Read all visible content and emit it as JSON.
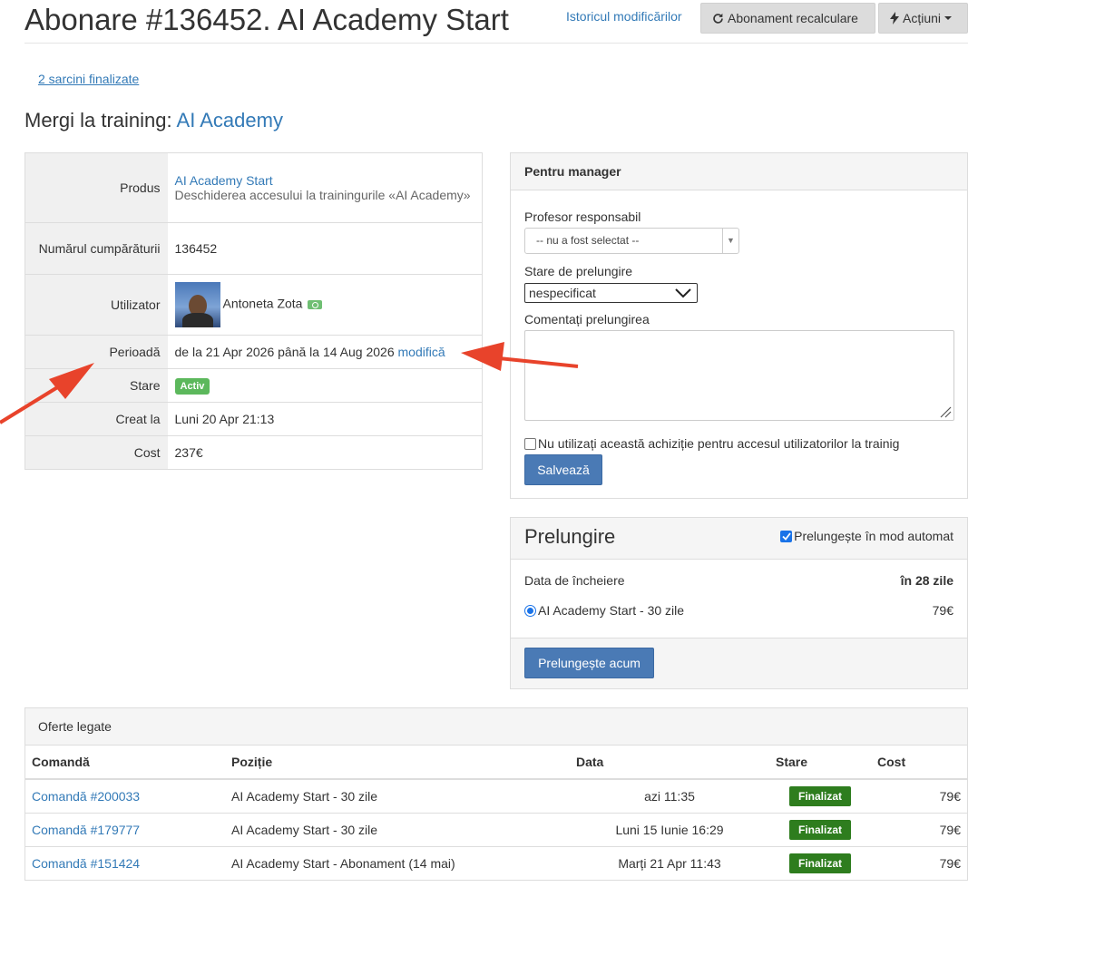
{
  "header": {
    "title": "Abonare #136452. AI Academy Start",
    "history_link": "Istoricul modificărilor",
    "recalc_button": "Abonament recalculare",
    "actions_button": "Acțiuni"
  },
  "tasks_link": "2 sarcini finalizate",
  "training": {
    "prefix": "Mergi la training:",
    "link": "AI Academy"
  },
  "details": {
    "product_label": "Produs",
    "product_name": "AI Academy Start",
    "product_desc": "Deschiderea accesului la trainingurile «AI Academy»",
    "purchase_label": "Numărul cumpărăturii",
    "purchase_number": "136452",
    "user_label": "Utilizator",
    "user_name": "Antoneta Zota",
    "period_label": "Perioadă",
    "period_value": "de la 21 Apr 2026 până la 14 Aug 2026",
    "period_modify": "modifică",
    "status_label": "Stare",
    "status_value": "Activ",
    "created_label": "Creat la",
    "created_value": "Luni 20 Apr 21:13",
    "cost_label": "Cost",
    "cost_value": "237€"
  },
  "manager": {
    "heading": "Pentru manager",
    "teacher_label": "Profesor responsabil",
    "teacher_value": "-- nu a fost selectat --",
    "extension_state_label": "Stare de prelungire",
    "extension_state_value": "nespecificat",
    "comment_label": "Comentați prelungirea",
    "comment_value": "",
    "no_access_label": "Nu utilizați această achiziție pentru accesul utilizatorilor la trainig",
    "no_access_checked": false,
    "save_button": "Salvează"
  },
  "extension": {
    "title": "Prelungire",
    "auto_label": "Prelungește în mod automat",
    "auto_checked": true,
    "end_date_label": "Data de încheiere",
    "end_date_value": "în 28 zile",
    "option_label": "AI Academy Start - 30 zile",
    "option_price": "79€",
    "extend_button": "Prelungește acum"
  },
  "offers": {
    "heading": "Oferte legate",
    "columns": [
      "Comandă",
      "Poziție",
      "Data",
      "Stare",
      "Cost"
    ],
    "rows": [
      {
        "order": "Comandă #200033",
        "position": "AI Academy Start - 30 zile",
        "date": "azi 11:35",
        "status": "Finalizat",
        "cost": "79€"
      },
      {
        "order": "Comandă #179777",
        "position": "AI Academy Start - 30 zile",
        "date": "Luni 15 Iunie 16:29",
        "status": "Finalizat",
        "cost": "79€"
      },
      {
        "order": "Comandă #151424",
        "position": "AI Academy Start - Abonament (14 mai)",
        "date": "Marți 21 Apr 11:43",
        "status": "Finalizat",
        "cost": "79€"
      }
    ]
  },
  "colors": {
    "link": "#337ab7",
    "active_badge": "#5cb85c",
    "finalized_badge": "#2e7d1e",
    "primary_button": "#4a7ab5",
    "annotation_arrow": "#e8432b"
  }
}
